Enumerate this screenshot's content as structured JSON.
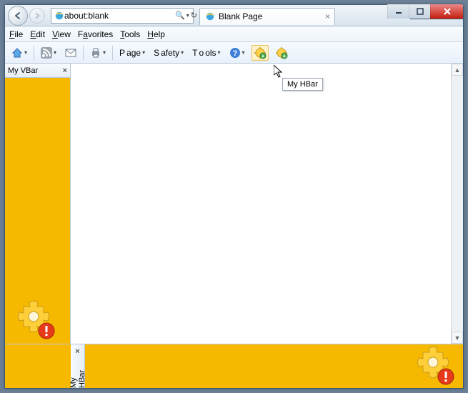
{
  "titlebar": {
    "address": "about:blank",
    "search_symbol": "🔍",
    "refresh_symbol": "↻",
    "stop_symbol": "✕"
  },
  "tab": {
    "title": "Blank Page"
  },
  "menubar": {
    "file": "File",
    "edit": "Edit",
    "view": "View",
    "favorites": "Favorites",
    "tools": "Tools",
    "help": "Help"
  },
  "toolbar": {
    "page": "Page",
    "safety": "Safety",
    "tools": "Tools"
  },
  "vbar": {
    "title": "My VBar"
  },
  "hbar": {
    "title": "My HBar"
  },
  "tooltip": {
    "text": "My HBar"
  },
  "colors": {
    "bar_bg": "#f7b900"
  }
}
